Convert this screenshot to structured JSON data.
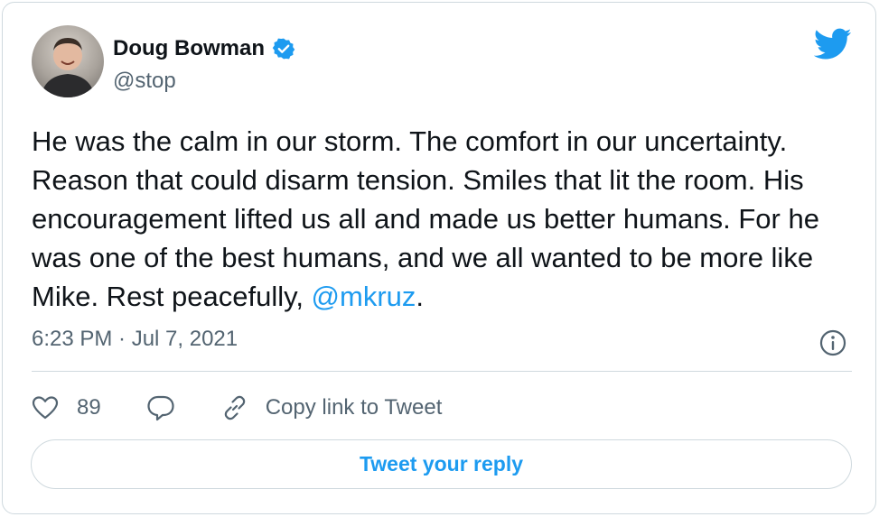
{
  "author": {
    "name": "Doug Bowman",
    "handle": "@stop",
    "verified": true
  },
  "tweet": {
    "text_before_mention": "He was the calm in our storm. The comfort in our uncertainty. Reason that could disarm tension. Smiles that lit the room. His encouragement lifted us all and made us better humans. For he was one of the best humans, and we all wanted to be more like Mike. Rest peacefully, ",
    "mention": "@mkruz",
    "text_after_mention": ".",
    "timestamp": "6:23 PM · Jul 7, 2021"
  },
  "actions": {
    "like_count": "89",
    "copy_link_label": "Copy link to Tweet",
    "reply_button_label": "Tweet your reply"
  },
  "icons": {
    "brand": "twitter-bird-icon",
    "verified": "verified-badge-icon",
    "info": "info-icon",
    "like": "heart-icon",
    "reply": "reply-bubble-icon",
    "copy": "link-icon"
  },
  "colors": {
    "accent": "#1d9bf0",
    "text": "#0f1419",
    "secondary": "#536471",
    "border": "#cfd9de"
  }
}
